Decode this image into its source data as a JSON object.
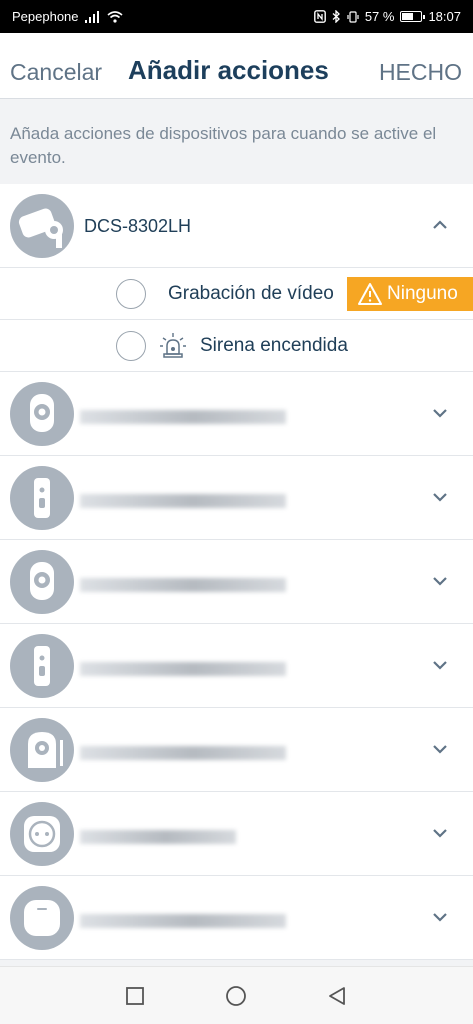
{
  "status_bar": {
    "carrier": "Pepephone",
    "battery": "57 %",
    "time": "18:07"
  },
  "header": {
    "cancel_label": "Cancelar",
    "title": "Añadir acciones",
    "done_label": "HECHO"
  },
  "subtitle": "Añada acciones de dispositivos para cuando se active el evento.",
  "expanded_device": {
    "name": "DCS-8302LH",
    "actions": [
      {
        "label": "Grabación de vídeo",
        "badge": "Ninguno",
        "badge_icon": "warning-icon"
      },
      {
        "label": "Sirena encendida",
        "icon": "siren-icon"
      }
    ]
  },
  "colors": {
    "accent": "#1d3f5c",
    "warning": "#f6a623",
    "avatar_bg": "#aab3bd"
  }
}
